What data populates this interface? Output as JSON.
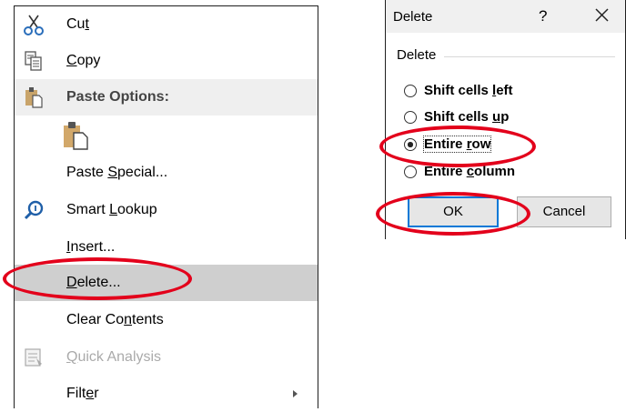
{
  "context_menu": {
    "cut": {
      "pre": "Cu",
      "acc": "t",
      "post": "",
      "icon": "scissors-icon"
    },
    "copy": {
      "pre": "",
      "acc": "C",
      "post": "opy",
      "icon": "copy-icon"
    },
    "paste_options": {
      "label": "Paste Options:",
      "icon": "clipboard-icon"
    },
    "paste_icon": "paste-clipboard-icon",
    "paste_special": {
      "pre": "Paste ",
      "acc": "S",
      "post": "pecial..."
    },
    "smart_lookup": {
      "pre": "Smart ",
      "acc": "L",
      "post": "ookup",
      "icon": "smart-lookup-icon"
    },
    "insert": {
      "pre": "",
      "acc": "I",
      "post": "nsert..."
    },
    "delete": {
      "pre": "",
      "acc": "D",
      "post": "elete..."
    },
    "clear_contents": {
      "pre": "Clear Co",
      "acc": "n",
      "post": "tents"
    },
    "quick_analysis": {
      "pre": "",
      "acc": "Q",
      "post": "uick Analysis",
      "icon": "quick-analysis-icon"
    },
    "filter": {
      "pre": "Filt",
      "acc": "e",
      "post": "r"
    }
  },
  "dialog": {
    "title": "Delete",
    "help": "?",
    "group_label": "Delete",
    "options": [
      {
        "pre": "Shift cells ",
        "acc": "l",
        "post": "eft",
        "selected": false
      },
      {
        "pre": "Shift cells ",
        "acc": "u",
        "post": "p",
        "selected": false
      },
      {
        "pre": "Entire ",
        "acc": "r",
        "post": "ow",
        "selected": true
      },
      {
        "pre": "Entire ",
        "acc": "c",
        "post": "olumn",
        "selected": false
      }
    ],
    "ok_label": "OK",
    "cancel_label": "Cancel"
  },
  "colors": {
    "annotation": "#e3001b",
    "focus_border": "#0078d7",
    "highlight": "#cfcfcf"
  }
}
